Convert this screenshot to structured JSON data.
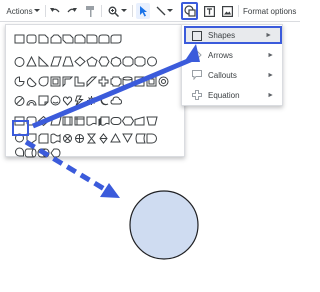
{
  "toolbar": {
    "actions_label": "Actions",
    "format_options_label": "Format options"
  },
  "shapes_menu": {
    "items": [
      {
        "label": "Shapes",
        "icon": "square-icon",
        "selected": true
      },
      {
        "label": "Arrows",
        "icon": "arrow-icon",
        "selected": false
      },
      {
        "label": "Callouts",
        "icon": "callout-icon",
        "selected": false
      },
      {
        "label": "Equation",
        "icon": "plus-icon",
        "selected": false
      }
    ]
  },
  "colors": {
    "accent": "#3b5bdb",
    "circle_fill": "#cfdcf1",
    "selected_bg": "#e8eaed"
  }
}
